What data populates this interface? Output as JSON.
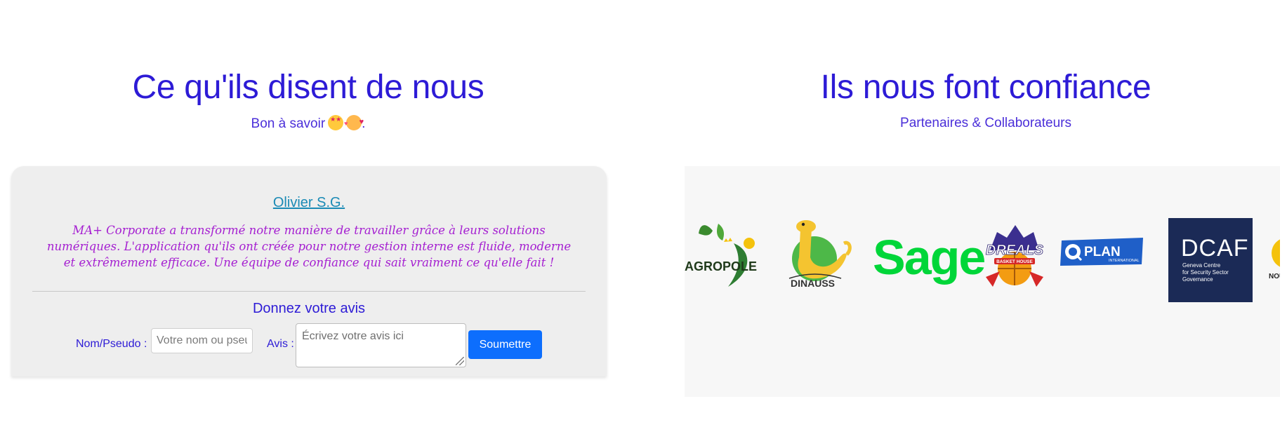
{
  "testimonials": {
    "title": "Ce qu'ils disent de nous",
    "subtitle": "Bon à savoir",
    "subtitle_suffix": ".",
    "subtitle_emojis": [
      "star-struck-emoji",
      "smiling-face-with-hearts-emoji"
    ],
    "review": {
      "author": "Olivier S.G.",
      "text": "MA+ Corporate a transformé notre manière de travailler grâce à leurs solutions numériques. L'application qu'ils ont créée pour notre gestion interne est fluide, moderne et extrêmement efficace. Une équipe de confiance qui sait vraiment ce qu'elle fait !"
    },
    "form": {
      "title": "Donnez votre avis",
      "name_label": "Nom/Pseudo :",
      "name_placeholder": "Votre nom ou pseudo",
      "review_label": "Avis :",
      "review_placeholder": "Écrivez votre avis ici",
      "submit_label": "Soumettre"
    }
  },
  "partners": {
    "title": "Ils nous font confiance",
    "subtitle": "Partenaires & Collaborateurs",
    "logos": [
      {
        "name": "agropole-logo",
        "text": "AGROPOLE"
      },
      {
        "name": "dinauss-logo",
        "text": "DINAUSS"
      },
      {
        "name": "sage-logo",
        "text": "Sage"
      },
      {
        "name": "dreals-logo",
        "text": "DREALS",
        "subtext": "BASKET HOUSE"
      },
      {
        "name": "plan-international-logo",
        "text": "PLAN",
        "subtext": "INTERNATIONAL"
      },
      {
        "name": "dcaf-logo",
        "text": "DCAF",
        "subtext_lines": [
          "Geneva Centre",
          "for Security Sector",
          "Governance"
        ]
      },
      {
        "name": "partial-logo",
        "text": "NOU"
      }
    ]
  },
  "colors": {
    "heading": "#2d1bd6",
    "link": "#1a8ab5",
    "review_text": "#a51fd1",
    "button": "#0d6efd",
    "sage_green": "#00d639",
    "dcaf_navy": "#1b2a56"
  }
}
